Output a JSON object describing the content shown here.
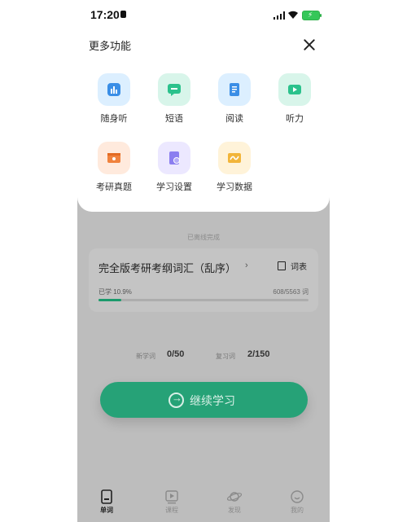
{
  "status": {
    "time": "17:20"
  },
  "sheet": {
    "title": "更多功能",
    "features": [
      {
        "label": "随身听",
        "icon": "bar-chart-icon",
        "bg": "#dcefff",
        "fg": "#3a8ee6"
      },
      {
        "label": "短语",
        "icon": "chat-bubble-icon",
        "bg": "#d8f5ea",
        "fg": "#2bc28c"
      },
      {
        "label": "阅读",
        "icon": "document-icon",
        "bg": "#dcefff",
        "fg": "#3a8ee6"
      },
      {
        "label": "听力",
        "icon": "play-video-icon",
        "bg": "#d8f5ea",
        "fg": "#2bc28c"
      },
      {
        "label": "考研真题",
        "icon": "exam-paper-icon",
        "bg": "#ffeadd",
        "fg": "#f0823d"
      },
      {
        "label": "学习设置",
        "icon": "settings-icon",
        "bg": "#ece8ff",
        "fg": "#8b7ef0"
      },
      {
        "label": "学习数据",
        "icon": "trend-chart-icon",
        "bg": "#fff3d9",
        "fg": "#f2b53a"
      }
    ]
  },
  "main": {
    "done_text": "已离线完成",
    "book_title": "完全版考研考纲词汇（乱序）",
    "chevron": "›",
    "wordlist_label": "词表",
    "studied_label": "已学 10.9%",
    "progress": 0.109,
    "count_label": "608/5563 词",
    "new_words_label": "新学词",
    "new_words_value": "0/50",
    "review_words_label": "复习词",
    "review_words_value": "2/150",
    "continue_label": "继续学习"
  },
  "tabs": [
    {
      "label": "单词",
      "icon": "word-card-icon",
      "active": true
    },
    {
      "label": "课程",
      "icon": "course-play-icon",
      "active": false
    },
    {
      "label": "发现",
      "icon": "planet-icon",
      "active": false
    },
    {
      "label": "我的",
      "icon": "smiley-icon",
      "active": false
    }
  ]
}
